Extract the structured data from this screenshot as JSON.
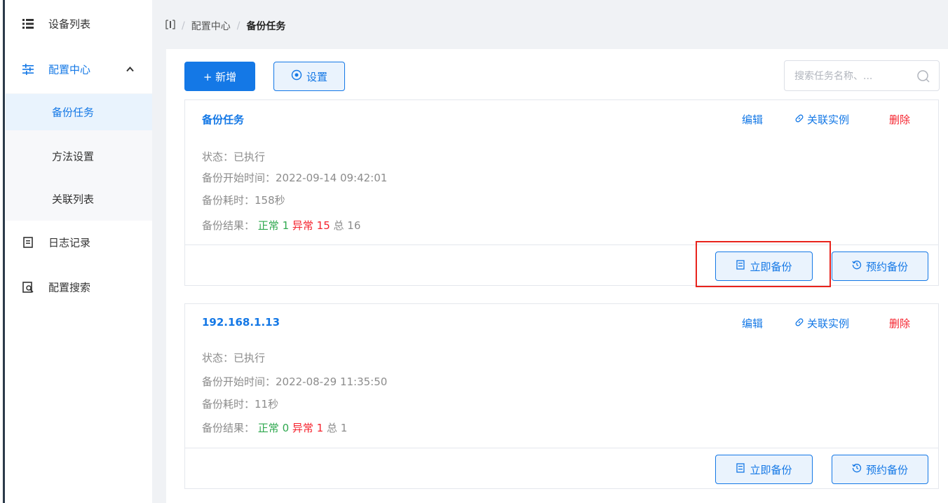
{
  "sidebar": {
    "items": [
      {
        "label": "设备列表",
        "icon": "list-icon"
      },
      {
        "label": "配置中心",
        "icon": "config-icon"
      },
      {
        "label": "备份任务"
      },
      {
        "label": "方法设置"
      },
      {
        "label": "关联列表"
      },
      {
        "label": "日志记录",
        "icon": "log-icon"
      },
      {
        "label": "配置搜索",
        "icon": "search-config-icon"
      }
    ],
    "expanded_caret": "^"
  },
  "breadcrumb": {
    "root_icon": "[·]",
    "sep": "/",
    "parent": "配置中心",
    "current": "备份任务"
  },
  "toolbar": {
    "add_label": "+ 新增",
    "settings_label": "设置"
  },
  "search": {
    "placeholder": "搜索任务名称、..."
  },
  "cards": [
    {
      "title": "备份任务",
      "edit": "编辑",
      "link": "关联实例",
      "delete": "删除",
      "status": "状态：已执行",
      "start_time": "备份开始时间：2022-09-14 09:42:01",
      "duration": "备份耗时：158秒",
      "result_label": "备份结果：",
      "normal": "正常 1",
      "abnormal": "异常 15",
      "total": "总 16",
      "backup_now": "立即备份",
      "schedule_backup": "预约备份"
    },
    {
      "title": "192.168.1.13",
      "edit": "编辑",
      "link": "关联实例",
      "delete": "删除",
      "status": "状态：已执行",
      "start_time": "备份开始时间：2022-08-29 11:35:50",
      "duration": "备份耗时：11秒",
      "result_label": "备份结果：",
      "normal": "正常 0",
      "abnormal": "异常 1",
      "total": "总 1",
      "backup_now": "立即备份",
      "schedule_backup": "预约备份"
    }
  ],
  "colors": {
    "accent": "#1478e6",
    "success": "#2fa84f",
    "danger": "#f5222d",
    "highlight": "#e8231c"
  }
}
